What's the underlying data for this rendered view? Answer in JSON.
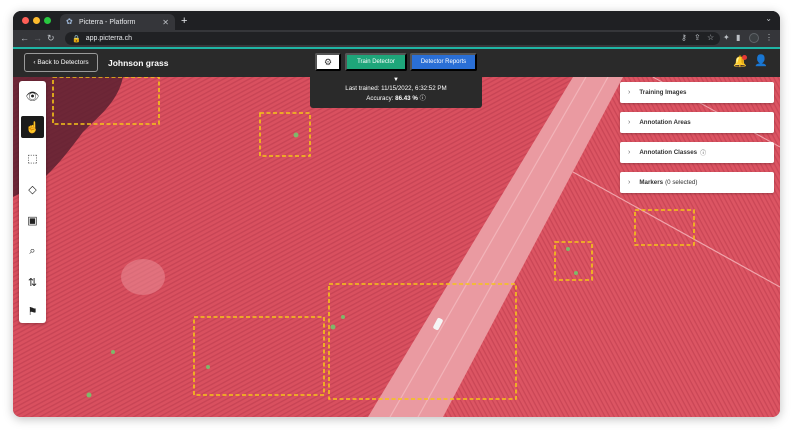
{
  "browser": {
    "tab_title": "Picterra - Platform",
    "new_tab": "+",
    "url": "app.picterra.ch",
    "tab_close": "✕"
  },
  "header": {
    "back_label": "‹ Back to Detectors",
    "detector_name": "Johnson grass",
    "gear_icon": "⚙",
    "train_label": "Train Detector",
    "reports_label": "Detector Reports"
  },
  "training_info": {
    "last_trained_label": "Last trained:",
    "last_trained_value": "11/15/2022, 6:32:52 PM",
    "accuracy_label": "Accuracy:",
    "accuracy_value": "86.43 %"
  },
  "toolbar": {
    "tools": [
      {
        "name": "visibility-tool",
        "glyph": "👁"
      },
      {
        "name": "pan-tool",
        "glyph": "☝"
      },
      {
        "name": "rectangle-tool",
        "glyph": "⬚"
      },
      {
        "name": "polygon-tool",
        "glyph": "◇"
      },
      {
        "name": "select-area-tool",
        "glyph": "▣"
      },
      {
        "name": "zoom-area-tool",
        "glyph": "⌕"
      },
      {
        "name": "sort-tool",
        "glyph": "⇅"
      },
      {
        "name": "flag-tool",
        "glyph": "⚑"
      }
    ]
  },
  "panel": {
    "items": [
      {
        "label": "Training Images",
        "extra": "",
        "info": false
      },
      {
        "label": "Annotation Areas",
        "extra": "",
        "info": false
      },
      {
        "label": "Annotation Classes",
        "extra": "",
        "info": true
      },
      {
        "label": "Markers",
        "extra": "(0 selected)",
        "info": false
      }
    ]
  },
  "colors": {
    "field": "#d9505f",
    "road": "#ea9aa1",
    "annotation": "#f5c518",
    "train": "#1ea67a",
    "reports": "#2a6fd6"
  }
}
